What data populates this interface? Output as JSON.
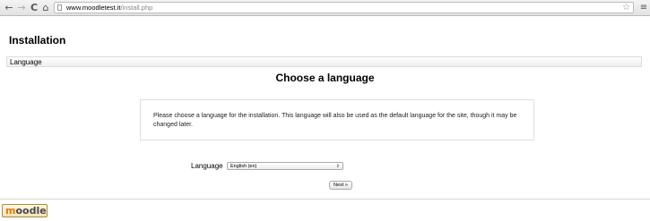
{
  "browser": {
    "url_host": "www.moodletest.it",
    "url_path": "/install.php",
    "back_icon": "←",
    "forward_icon": "→",
    "reload_icon": "C",
    "home_icon": "⌂",
    "star_icon": "☆",
    "menu_icon": "≡"
  },
  "page": {
    "title": "Installation",
    "navbar_label": "Language",
    "heading": "Choose a language",
    "info_text": "Please choose a language for the installation. This language will also be used as the default language for the site, though it may be changed later."
  },
  "form": {
    "language_label": "Language",
    "language_selected": "English (en)",
    "next_label": "Next »"
  },
  "footer": {
    "logo_m": "m",
    "logo_rest": "oodle"
  }
}
